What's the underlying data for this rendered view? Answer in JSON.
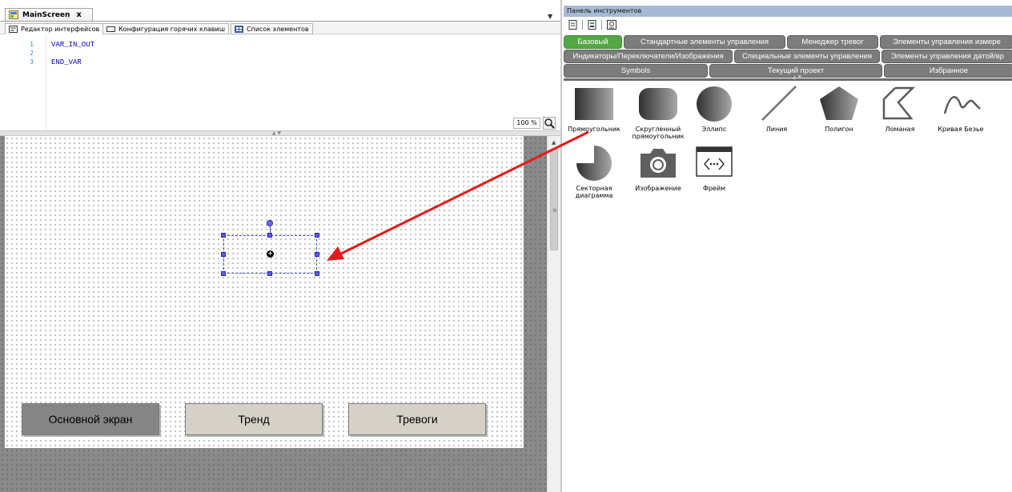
{
  "editor": {
    "doc_tab": {
      "title": "MainScreen",
      "close": "x"
    },
    "sub_tabs": [
      {
        "label": "Редактор интерфейсов"
      },
      {
        "label": "Конфигурация горячих клавиш"
      },
      {
        "label": "Список элементов"
      }
    ],
    "code_lines": [
      {
        "num": "1",
        "text": "VAR_IN_OUT"
      },
      {
        "num": "2",
        "text": ""
      },
      {
        "num": "3",
        "text": "END_VAR"
      }
    ],
    "zoom": "100 %",
    "canvas_buttons": [
      {
        "label": "Основной экран"
      },
      {
        "label": "Тренд"
      },
      {
        "label": "Тревоги"
      }
    ]
  },
  "toolbox": {
    "title": "Панель инструментов",
    "categories_row1": [
      {
        "label": "Базовый",
        "active": true
      },
      {
        "label": "Стандартные элементы управления",
        "active": false
      },
      {
        "label": "Менеджер тревог",
        "active": false
      },
      {
        "label": "Элементы управления измере",
        "active": false
      }
    ],
    "categories_row2": [
      {
        "label": "Индикаторы/Переключатели/Изображения"
      },
      {
        "label": "Специальные элементы управления"
      },
      {
        "label": "Элементы управления датой/вр"
      }
    ],
    "categories_row3": [
      {
        "label": "Symbols"
      },
      {
        "label": "Текущий проект"
      },
      {
        "label": "Избранное"
      }
    ],
    "tools": [
      {
        "label": "Прямоугольник",
        "icon": "rectangle-icon"
      },
      {
        "label": "Скругленный прямоугольник",
        "icon": "rounded-rectangle-icon"
      },
      {
        "label": "Эллипс",
        "icon": "ellipse-icon"
      },
      {
        "label": "Линия",
        "icon": "line-icon"
      },
      {
        "label": "Полигон",
        "icon": "polygon-icon"
      },
      {
        "label": "Ломаная",
        "icon": "polyline-icon"
      },
      {
        "label": "Кривая Безье",
        "icon": "bezier-curve-icon"
      },
      {
        "label": "Секторная диаграмма",
        "icon": "pie-icon"
      },
      {
        "label": "Изображение",
        "icon": "camera-icon"
      },
      {
        "label": "Фрейм",
        "icon": "frame-icon"
      }
    ]
  },
  "colors": {
    "active_category": "#55a645",
    "category": "#7c7c7c",
    "title_bar": "#a8b9d6",
    "annotation_arrow": "#e31b1b",
    "selection": "#3f48cc"
  }
}
